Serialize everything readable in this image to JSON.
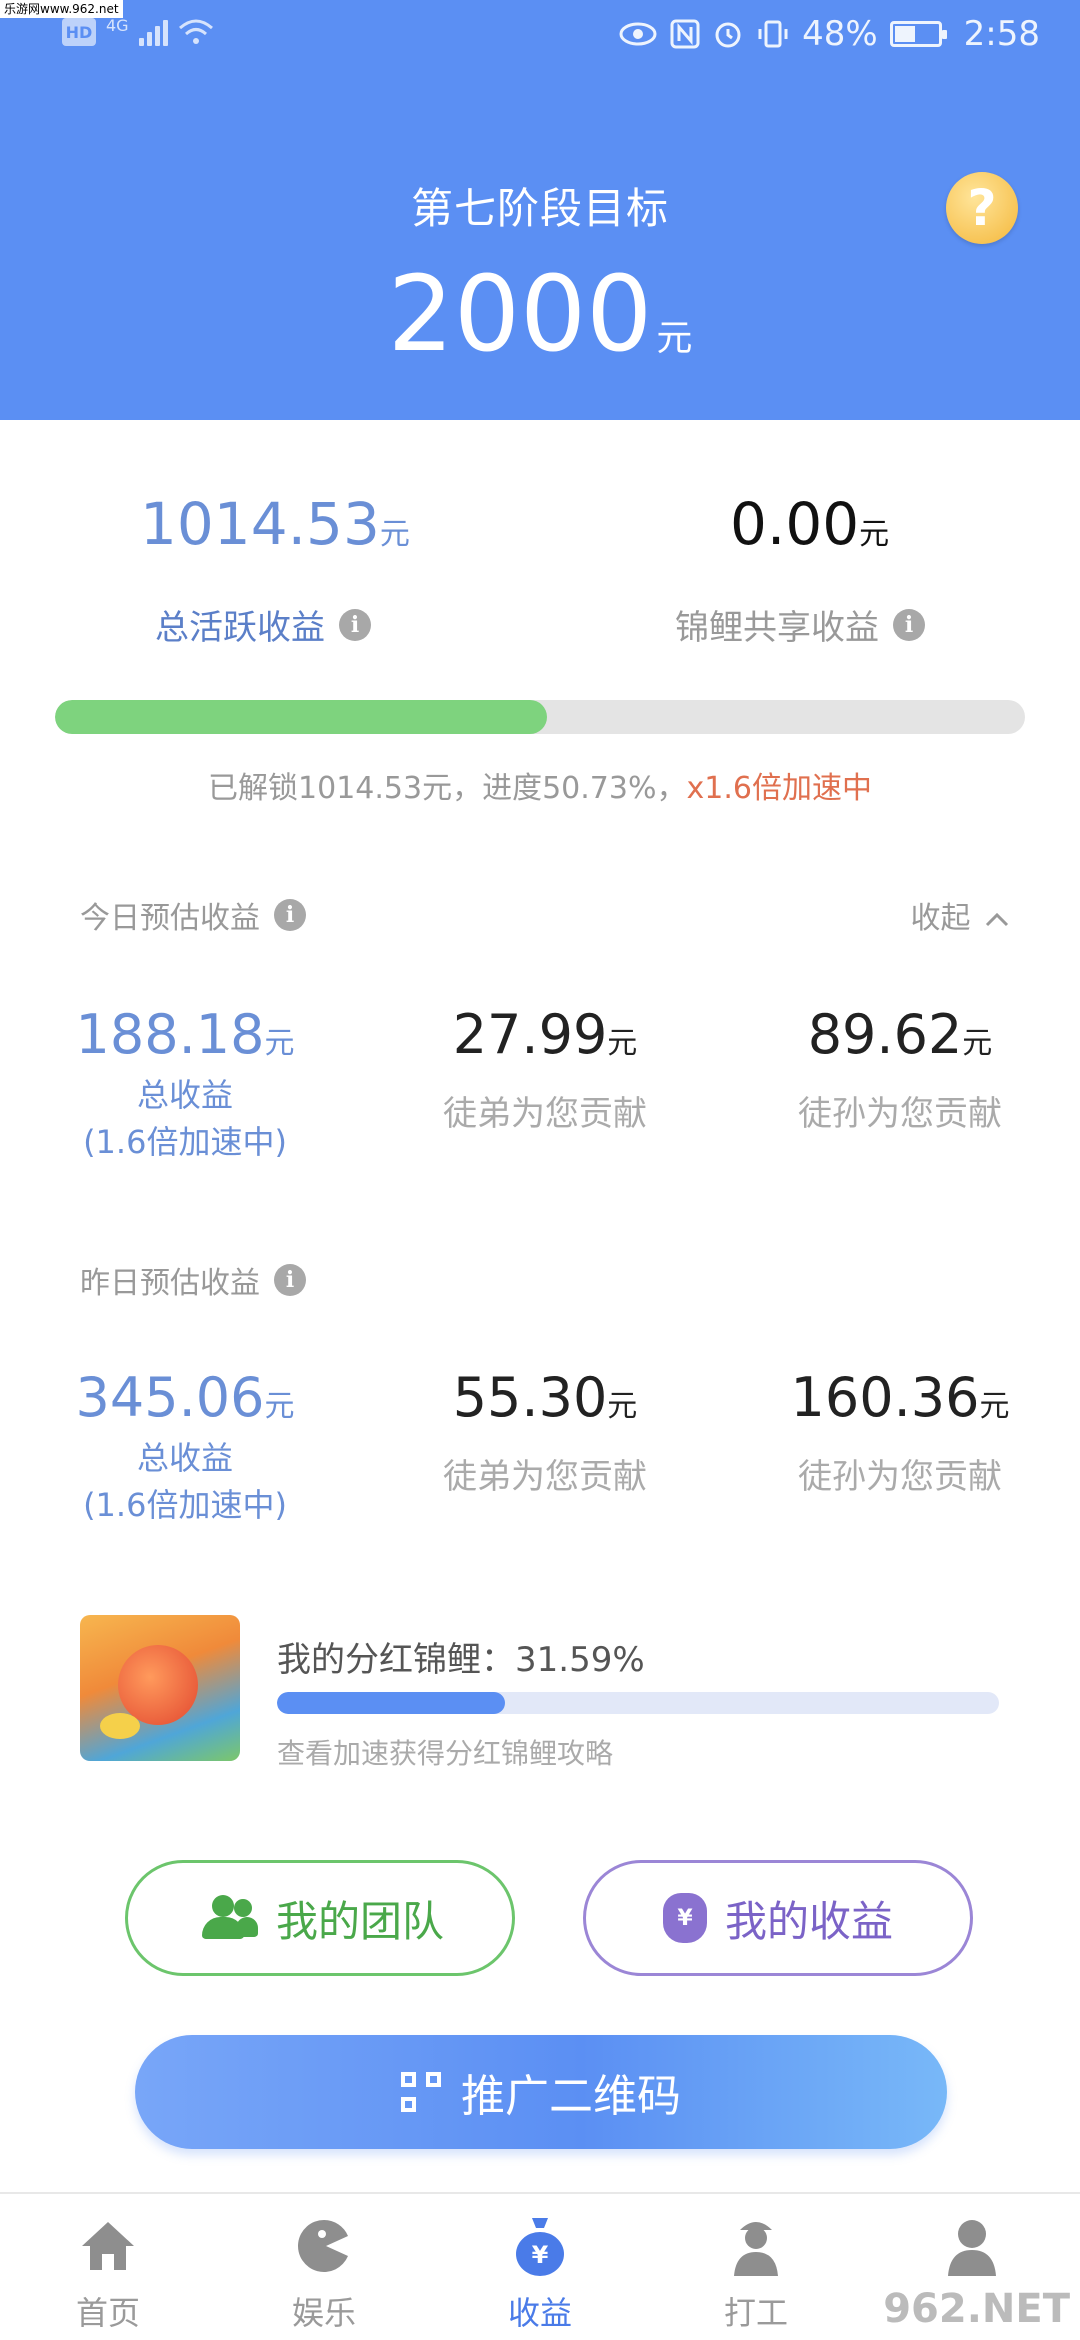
{
  "watermark": "乐游网www.962.net",
  "status_bar": {
    "left_badge": "HD",
    "network": "4G",
    "battery": "48%",
    "time": "2:58"
  },
  "header": {
    "stage_title": "第七阶段目标",
    "target_amount": "2000",
    "unit": "元",
    "help_label": "?"
  },
  "summary": {
    "active_income": "1014.53",
    "active_income_unit": "元",
    "active_income_label": "总活跃收益",
    "carp_share_income": "0.00",
    "carp_share_income_unit": "元",
    "carp_share_label": "锦鲤共享收益",
    "info_label": "i",
    "progress_fraction": 0.5073,
    "progress_text": "已解锁1014.53元，进度50.73%，",
    "progress_accel": "x1.6倍加速中"
  },
  "today": {
    "title": "今日预估收益",
    "collapse_label": "收起",
    "total": "188.18",
    "total_label": "总收益",
    "total_note": "(1.6倍加速中)",
    "apprentice": "27.99",
    "apprentice_label": "徒弟为您贡献",
    "grand_apprentice": "89.62",
    "grand_apprentice_label": "徒孙为您贡献",
    "unit": "元"
  },
  "yesterday": {
    "title": "昨日预估收益",
    "total": "345.06",
    "total_label": "总收益",
    "total_note": "(1.6倍加速中)",
    "apprentice": "55.30",
    "apprentice_label": "徒弟为您贡献",
    "grand_apprentice": "160.36",
    "grand_apprentice_label": "徒孙为您贡献",
    "unit": "元"
  },
  "carp": {
    "title": "我的分红锦鲤：31.59%",
    "fraction": 0.3159,
    "link": "查看加速获得分红锦鲤攻略"
  },
  "actions": {
    "team": "我的团队",
    "income": "我的收益",
    "income_icon_text": "¥",
    "qr": "推广二维码"
  },
  "nav": {
    "home": "首页",
    "fun": "娱乐",
    "income": "收益",
    "work": "打工",
    "me": "",
    "active": "income",
    "watermark": "962.NET"
  },
  "colors": {
    "brand_blue": "#5b8ff3",
    "progress_green": "#7ed37e",
    "accent_orange": "#e0704f",
    "team_green": "#4aa84a",
    "income_purple": "#7b63c7"
  }
}
